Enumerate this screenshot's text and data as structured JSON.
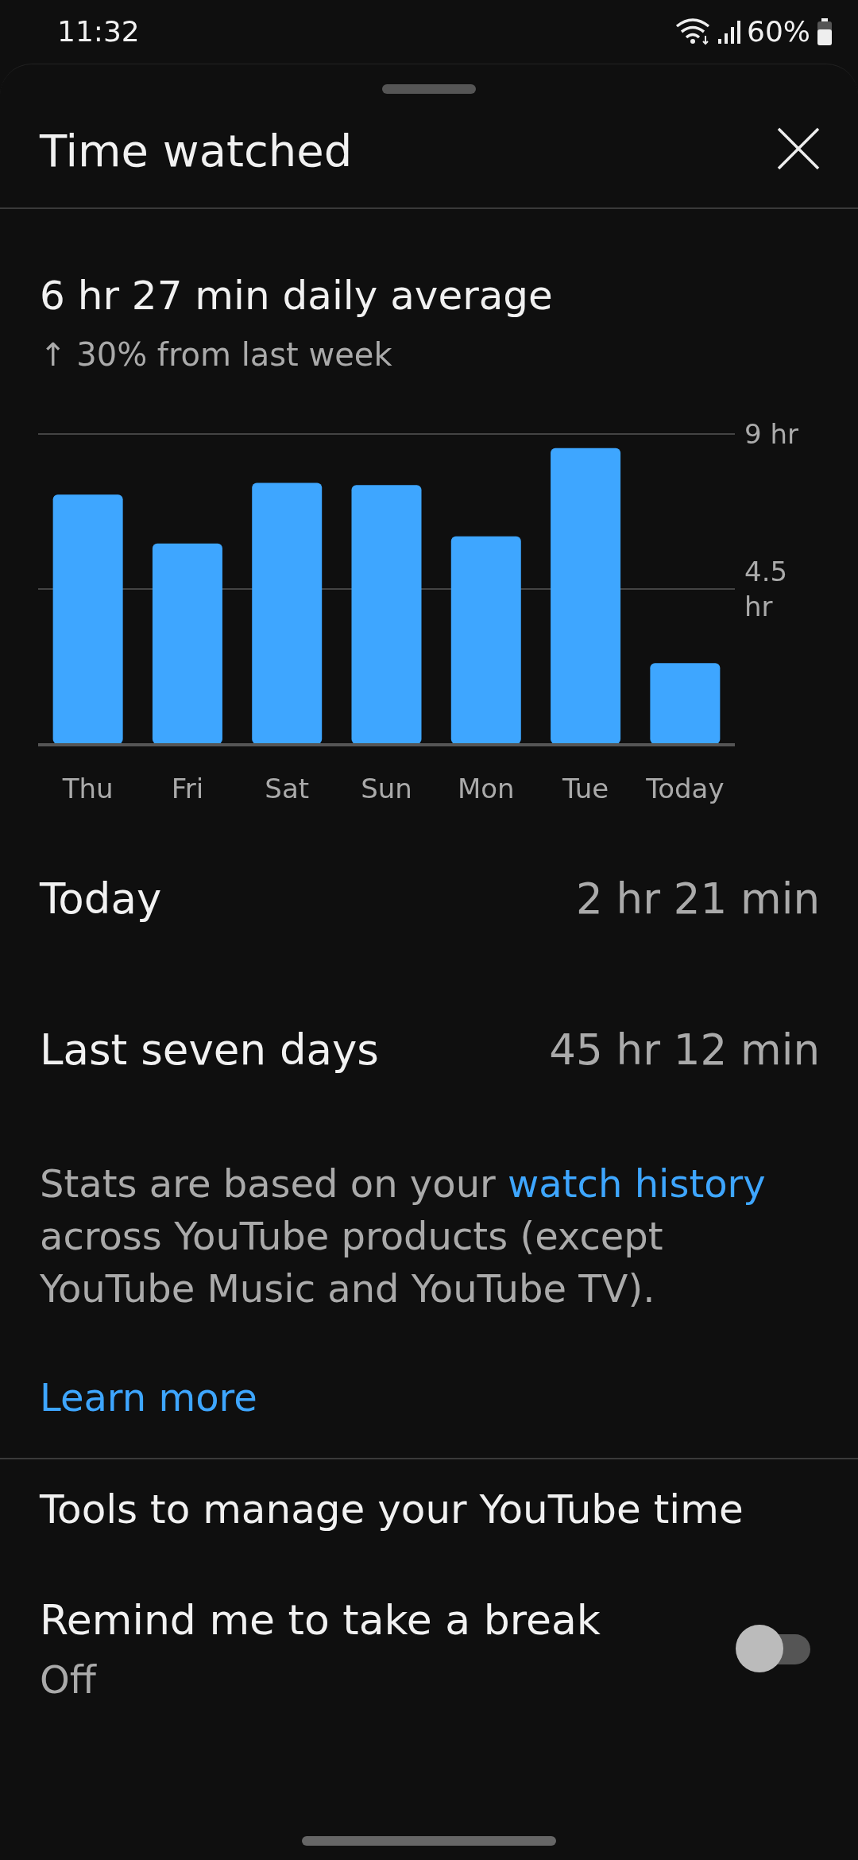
{
  "status_bar": {
    "time": "11:32",
    "battery": "60%"
  },
  "sheet": {
    "title": "Time watched"
  },
  "summary": {
    "headline": "6 hr 27 min daily average",
    "change": "↑ 30% from last week"
  },
  "chart_data": {
    "type": "bar",
    "categories": [
      "Thu",
      "Fri",
      "Sat",
      "Sun",
      "Mon",
      "Tue",
      "Today"
    ],
    "series": [
      {
        "color": "#3ea6ff",
        "values": [
          7.24,
          5.82,
          7.58,
          7.52,
          6.03,
          8.59,
          2.35
        ]
      }
    ],
    "ylim": [
      0,
      9
    ],
    "yticks": [
      {
        "value": 4.5,
        "label": "4.5 hr"
      },
      {
        "value": 9,
        "label": "9 hr"
      }
    ]
  },
  "stats": [
    {
      "label": "Today",
      "value": "2 hr 21 min"
    },
    {
      "label": "Last seven days",
      "value": "45 hr 12 min"
    }
  ],
  "note": {
    "before": "Stats are based on your",
    "link": "watch history",
    "after": "across YouTube products (except YouTube Music and YouTube TV)."
  },
  "learn_more": "Learn more",
  "tools": {
    "title": "Tools to manage your YouTube time",
    "items": [
      {
        "label": "Remind me to take a break",
        "status": "Off",
        "on": false
      }
    ]
  }
}
